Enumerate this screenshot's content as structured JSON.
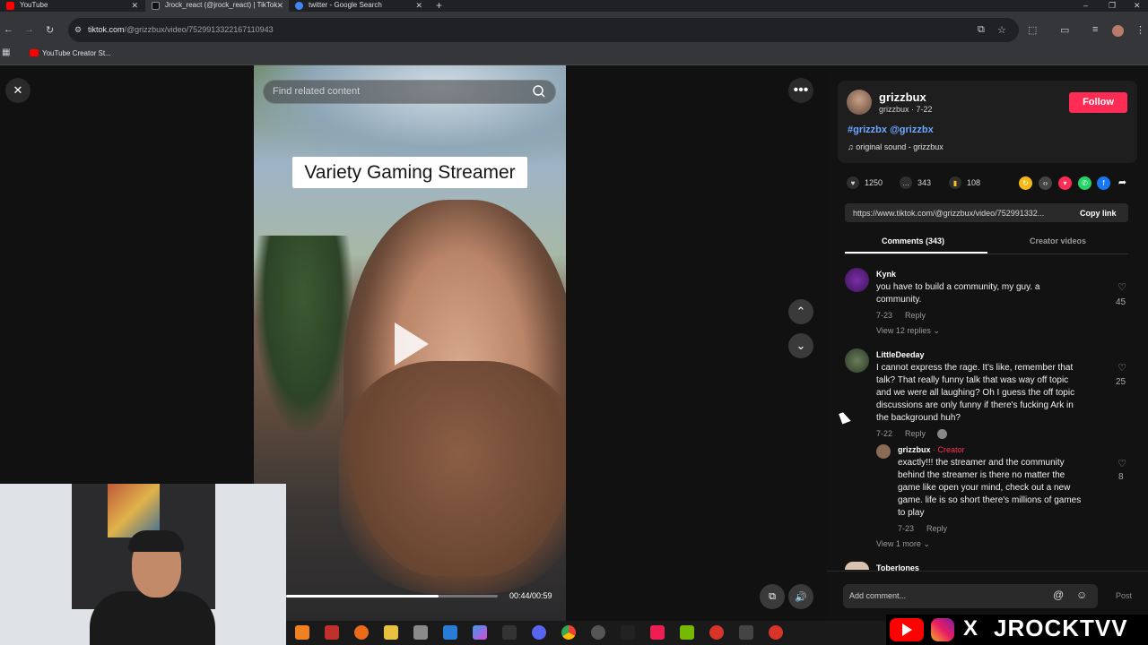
{
  "browser": {
    "tabs": [
      {
        "label": "YouTube",
        "color": "#ff0000",
        "active": false
      },
      {
        "label": "Jrock_react (@jrock_react) | TikTok",
        "color": "#ffffff",
        "active": true
      },
      {
        "label": "twitter - Google Search",
        "color": "#4285f4",
        "active": false
      }
    ],
    "new_tab": "+",
    "url_host": "tiktok.com",
    "url_path": "/@grizzbux/video/7529913322167110943",
    "bookmark": "YouTube Creator St..."
  },
  "video": {
    "search_placeholder": "Find related content",
    "caption": "Variety Gaming Streamer",
    "progress": 0.72,
    "timecode": "00:44/00:59"
  },
  "post": {
    "author": "grizzbux",
    "author_sub": "grizzbux · 7-22",
    "follow_label": "Follow",
    "tags": "#grizzbx @grizzbx",
    "sound": "♫  original sound - grizzbux",
    "likes": "1250",
    "comments": "343",
    "saves": "108",
    "link": "https://www.tiktok.com/@grizzbux/video/752991332...",
    "copy_link": "Copy link",
    "tab_comments": "Comments (343)",
    "tab_creator": "Creator videos"
  },
  "comments": [
    {
      "name": "Kynk",
      "text1": "you have to build a community, my guy. a",
      "text2": "community.",
      "date": "7-23",
      "reply": "Reply",
      "likes": "45",
      "view_replies": "View 12 replies ⌄"
    },
    {
      "name": "LittleDeeday",
      "lines": [
        "I cannot express the rage. It's like, remember that",
        "talk? That really funny talk that was way off topic",
        "and we were all laughing? Oh I guess the off topic",
        "discussions are only funny if there's fucking Ark in",
        "the background huh?"
      ],
      "date": "7-22",
      "reply": "Reply",
      "likes": "25"
    },
    {
      "name": "grizzbux",
      "badge": "· Creator",
      "lines": [
        "exactly!!! the streamer and the community",
        "behind the streamer is there no matter the",
        "game like open your mind, check out a new",
        "game. life is so short there's millions of games",
        "to play"
      ],
      "date": "7-23",
      "reply": "Reply",
      "likes": "8",
      "view_more": "View 1 more ⌄"
    },
    {
      "name": "Toberlones"
    }
  ],
  "composer": {
    "placeholder": "Add comment...",
    "post": "Post"
  },
  "overlay_brand": "JROCKTVV"
}
